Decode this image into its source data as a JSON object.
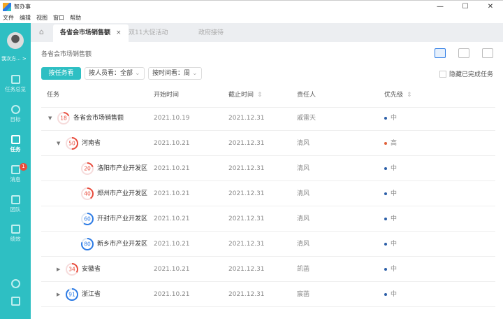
{
  "app": {
    "title": "智办事",
    "menu": [
      "文件",
      "编辑",
      "视图",
      "窗口",
      "帮助"
    ],
    "window_controls": [
      "—",
      "☐",
      "✕"
    ]
  },
  "user": {
    "name": "我次方..."
  },
  "sidebar": {
    "items": [
      {
        "label": "任务总览",
        "icon": "overview-icon"
      },
      {
        "label": "目标",
        "icon": "target-icon"
      },
      {
        "label": "任务",
        "icon": "task-icon",
        "active": true
      },
      {
        "label": "消息",
        "icon": "message-icon",
        "badge": "1"
      },
      {
        "label": "团队",
        "icon": "team-icon"
      },
      {
        "label": "绩效",
        "icon": "performance-icon"
      }
    ]
  },
  "tabs": [
    {
      "label": "各省会市场销售额",
      "active": true,
      "close": "×"
    },
    {
      "label": "双11大促活动"
    },
    {
      "label": "政府接待"
    }
  ],
  "breadcrumb": "各省会市场销售额",
  "toolbar": {
    "by_task": "按任务看",
    "by_person": "按人员看：全部",
    "by_time": "按时间看：周",
    "hide_done": "隐藏已完成任务"
  },
  "table": {
    "headers": [
      "任务",
      "开始时间",
      "截止时间",
      "责任人",
      "优先级"
    ],
    "rows": [
      {
        "level": 0,
        "expand": "down",
        "progress": 18,
        "name": "各省会市场销售额",
        "start": "2021.10.19",
        "end": "2021.12.31",
        "owner": "戚雷天",
        "priority": "中"
      },
      {
        "level": 1,
        "expand": "down",
        "progress": 50,
        "name": "河南省",
        "start": "2021.10.21",
        "end": "2021.12.31",
        "owner": "清风",
        "priority": "高"
      },
      {
        "level": 2,
        "progress": 20,
        "name": "洛阳市产业开发区",
        "start": "2021.10.21",
        "end": "2021.12.31",
        "owner": "清风",
        "priority": "中"
      },
      {
        "level": 2,
        "progress": 40,
        "name": "郑州市产业开发区",
        "start": "2021.10.21",
        "end": "2021.12.31",
        "owner": "清风",
        "priority": "中"
      },
      {
        "level": 2,
        "progress": 60,
        "name": "开封市产业开发区",
        "start": "2021.10.21",
        "end": "2021.12.31",
        "owner": "清风",
        "priority": "中"
      },
      {
        "level": 2,
        "progress": 80,
        "name": "新乡市产业开发区",
        "start": "2021.10.21",
        "end": "2021.12.31",
        "owner": "清风",
        "priority": "中"
      },
      {
        "level": 1,
        "expand": "right",
        "progress": 34,
        "name": "安徽省",
        "start": "2021.10.21",
        "end": "2021.12.31",
        "owner": "凯菡",
        "priority": "中"
      },
      {
        "level": 1,
        "expand": "right",
        "progress": 91,
        "name": "浙江省",
        "start": "2021.10.21",
        "end": "2021.12.31",
        "owner": "宸菡",
        "priority": "中"
      }
    ]
  },
  "colors": {
    "teal": "#2ebfc3",
    "red": "#e84c3d",
    "blue": "#2c7be5",
    "priority_mid": "#2c5fa8",
    "priority_high": "#e0613a"
  }
}
